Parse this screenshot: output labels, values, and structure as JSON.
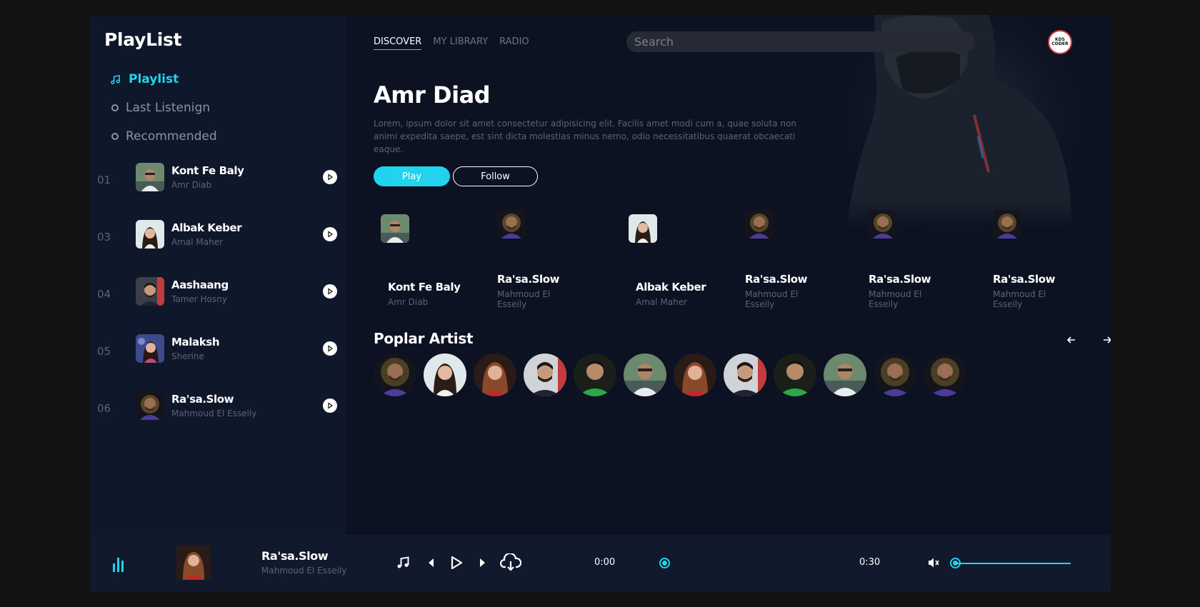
{
  "sidebar": {
    "brand": "PlayList",
    "nav": [
      {
        "label": "Playlist"
      },
      {
        "label": "Last Listenign"
      },
      {
        "label": "Recommended"
      }
    ],
    "tracks": [
      {
        "num": "01",
        "title": "Kont Fe Baly",
        "artist": "Amr Diab"
      },
      {
        "num": "03",
        "title": "Albak Keber",
        "artist": "Amal Maher"
      },
      {
        "num": "04",
        "title": "Aashaang",
        "artist": "Tamer Hosny"
      },
      {
        "num": "05",
        "title": "Malaksh",
        "artist": "Sherine"
      },
      {
        "num": "06",
        "title": "Ra'sa.Slow",
        "artist": "Mahmoud El Esseily"
      }
    ]
  },
  "header": {
    "tabs": [
      "DISCOVER",
      "MY LIBRARY",
      "RADIO"
    ],
    "search_placeholder": "Search",
    "avatar_text": [
      "KDS",
      "CODER"
    ]
  },
  "hero": {
    "name": "Amr Diad",
    "description": "Lorem, ipsum dolor sit amet consectetur adipisicing elit. Facilis amet modi cum a, quae soluta non animi expedita saepe, est sint dicta molestias minus nemo, odio necessitatibus quaerat obcaecati eaque.",
    "play_label": "Play",
    "follow_label": "Follow"
  },
  "cards": [
    {
      "title": "Kont Fe Baly",
      "artist": "Amr Diab"
    },
    {
      "title": "Ra'sa.Slow",
      "artist": "Mahmoud El Esseily"
    },
    {
      "title": "Albak Keber",
      "artist": "Amal Maher"
    },
    {
      "title": "Ra'sa.Slow",
      "artist": "Mahmoud El Esseily"
    },
    {
      "title": "Ra'sa.Slow",
      "artist": "Mahmoud El Esseily"
    },
    {
      "title": "Ra'sa.Slow",
      "artist": "Mahmoud El Esseily"
    }
  ],
  "popular": {
    "title": "Poplar Artist"
  },
  "player": {
    "title": "Ra'sa.Slow",
    "artist": "Mahmoud El Esseily",
    "current_time": "0:00",
    "duration": "0:30",
    "progress": 0,
    "volume": 0
  },
  "colors": {
    "accent": "#22d3ee",
    "background": "#0c1222",
    "sidebar": "#0f172a"
  }
}
